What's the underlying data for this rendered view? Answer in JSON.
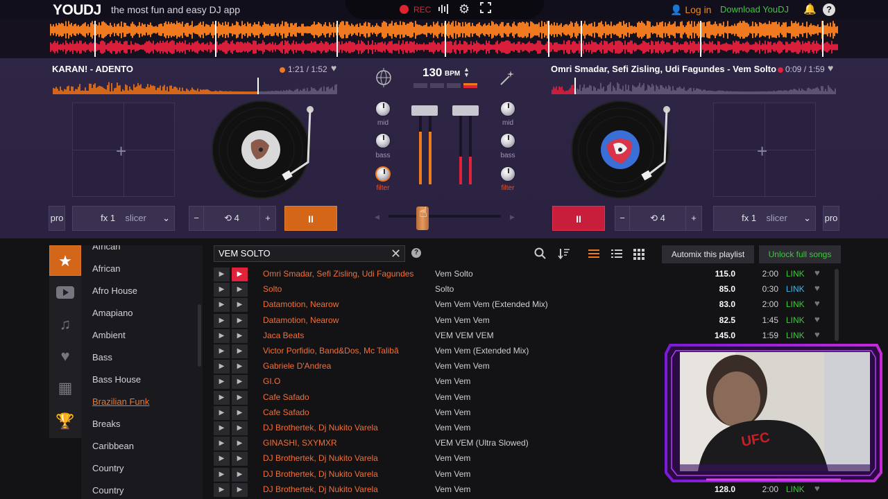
{
  "topbar": {
    "logo": "YOUDJ",
    "tagline": "the most fun and easy DJ app",
    "rec_label": "REC",
    "login": "Log in",
    "download": "Download YouDJ",
    "help": "?"
  },
  "colors": {
    "accent": "#f07a20",
    "deck_left": "#d4661a",
    "deck_right": "#c81e3c",
    "link_green": "#3ec93e",
    "link_blue": "#45b6e8"
  },
  "deck_left": {
    "title": "KARAN! - ADENTO",
    "time": "1:21 / 1:52",
    "pad_fx": "fx 1",
    "pad_mode": "slicer",
    "pro": "pro",
    "loop_minus": "−",
    "loop_value": "4",
    "loop_plus": "+",
    "pause": "II",
    "progress": 0.72
  },
  "deck_right": {
    "title": "Omri Smadar, Sefi Zisling, Udi Fagundes - Vem Solto",
    "time": "0:09 / 1:59",
    "pad_fx": "fx 1",
    "pad_mode": "slicer",
    "pro": "pro",
    "loop_minus": "−",
    "loop_value": "4",
    "loop_plus": "+",
    "pause": "II",
    "progress": 0.08
  },
  "mixer": {
    "bpm": "130",
    "bpm_unit": "BPM",
    "knob_mid": "mid",
    "knob_bass": "bass",
    "knob_filter": "filter",
    "crossfader": 0.3
  },
  "browser": {
    "search_value": "VEM SOLTO",
    "automix": "Automix this playlist",
    "unlock": "Unlock full songs",
    "side_icons": [
      "star-icon",
      "youtube-icon",
      "music-note-icon",
      "heart-icon",
      "grid-icon",
      "trophy-icon"
    ],
    "genres": [
      "African",
      "African",
      "Afro House",
      "Amapiano",
      "Ambient",
      "Bass",
      "Bass House",
      "Brazilian Funk",
      "Breaks",
      "Caribbean",
      "Country",
      "Country"
    ],
    "active_genre_index": 7,
    "tracks": [
      {
        "artist": "Omri Smadar, Sefi Zisling, Udi Fagundes",
        "title": "Vem Solto",
        "bpm": "115.0",
        "len": "2:00",
        "link": "LINK",
        "hot": true,
        "link_color": "green"
      },
      {
        "artist": "Solto",
        "title": "Solto",
        "bpm": "85.0",
        "len": "0:30",
        "link": "LINK",
        "hot": false,
        "link_color": "blue"
      },
      {
        "artist": "Datamotion, Nearow",
        "title": "Vem Vem Vem (Extended Mix)",
        "bpm": "83.0",
        "len": "2:00",
        "link": "LINK",
        "hot": false,
        "link_color": "green"
      },
      {
        "artist": "Datamotion, Nearow",
        "title": "Vem Vem Vem",
        "bpm": "82.5",
        "len": "1:45",
        "link": "LINK",
        "hot": false,
        "link_color": "green"
      },
      {
        "artist": "Jaca Beats",
        "title": "VEM VEM VEM",
        "bpm": "145.0",
        "len": "1:59",
        "link": "LINK",
        "hot": false,
        "link_color": "green"
      },
      {
        "artist": "Victor Porfidio, Band&Dos, Mc Talibã",
        "title": "Vem Vem (Extended Mix)",
        "bpm": "",
        "len": "",
        "link": "",
        "hot": false,
        "link_color": "green"
      },
      {
        "artist": "Gabriele D'Andrea",
        "title": "Vem Vem Vem",
        "bpm": "",
        "len": "",
        "link": "",
        "hot": false,
        "link_color": "green"
      },
      {
        "artist": "GI.O",
        "title": "Vem Vem",
        "bpm": "",
        "len": "",
        "link": "",
        "hot": false,
        "link_color": "green"
      },
      {
        "artist": "Cafe Safado",
        "title": "Vem Vem",
        "bpm": "",
        "len": "",
        "link": "",
        "hot": false,
        "link_color": "green"
      },
      {
        "artist": "Cafe Safado",
        "title": "Vem Vem",
        "bpm": "",
        "len": "",
        "link": "",
        "hot": false,
        "link_color": "green"
      },
      {
        "artist": "DJ Brothertek, Dj Nukito Varela",
        "title": "Vem Vem",
        "bpm": "",
        "len": "",
        "link": "",
        "hot": false,
        "link_color": "green"
      },
      {
        "artist": "GINASHI, SXYMXR",
        "title": "VEM VEM (Ultra Slowed)",
        "bpm": "",
        "len": "",
        "link": "",
        "hot": false,
        "link_color": "green"
      },
      {
        "artist": "DJ Brothertek, Dj Nukito Varela",
        "title": "Vem Vem",
        "bpm": "",
        "len": "",
        "link": "",
        "hot": false,
        "link_color": "green"
      },
      {
        "artist": "DJ Brothertek, Dj Nukito Varela",
        "title": "Vem Vem",
        "bpm": "",
        "len": "",
        "link": "",
        "hot": false,
        "link_color": "green"
      },
      {
        "artist": "DJ Brothertek, Dj Nukito Varela",
        "title": "Vem Vem",
        "bpm": "128.0",
        "len": "2:00",
        "link": "LINK",
        "hot": false,
        "link_color": "green"
      }
    ]
  }
}
